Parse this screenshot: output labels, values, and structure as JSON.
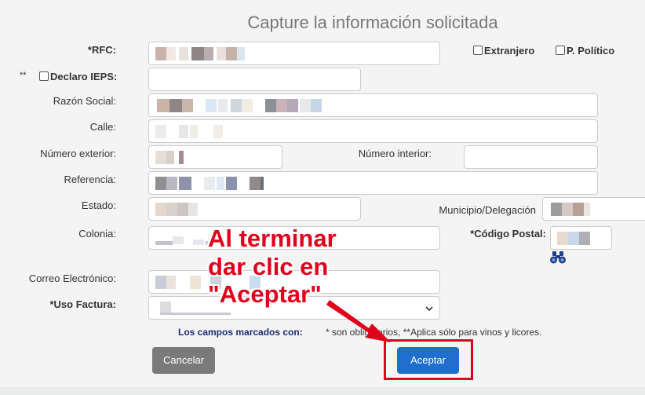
{
  "form": {
    "title": "Capture la información solicitada",
    "rfc_label": "*RFC:",
    "extranjero_label": "Extranjero",
    "politico_label": "P. Político",
    "ieps_prefix": "**",
    "ieps_label": "Declaro IEPS:",
    "razon_social_label": "Razón Social:",
    "calle_label": "Calle:",
    "num_ext_label": "Número exterior:",
    "num_int_label": "Número interior:",
    "referencia_label": "Referencia:",
    "estado_label": "Estado:",
    "municipio_label": "Municipio/Delegación",
    "colonia_label": "Colonia:",
    "codigo_postal_label": "*Código Postal:",
    "correo_label": "Correo Electrónico:",
    "uso_factura_label": "*Uso Factura:",
    "note_marked": "Los campos marcados con:",
    "note_rest": "* son obligatorios, **Aplica sólo para vinos y licores.",
    "cancel_label": "Cancelar",
    "accept_label": "Aceptar"
  },
  "annotation": {
    "line1": "Al terminar",
    "line2": "dar clic en",
    "line3": "\"Aceptar\"",
    "color": "#e0001b"
  },
  "icons": {
    "search": "binoculars-icon",
    "dropdown": "chevron-down-icon"
  },
  "colors": {
    "accept_button": "#1f6fcf",
    "cancel_button": "#7a7a7a",
    "highlight_box": "#e0001b",
    "title": "#777777"
  }
}
